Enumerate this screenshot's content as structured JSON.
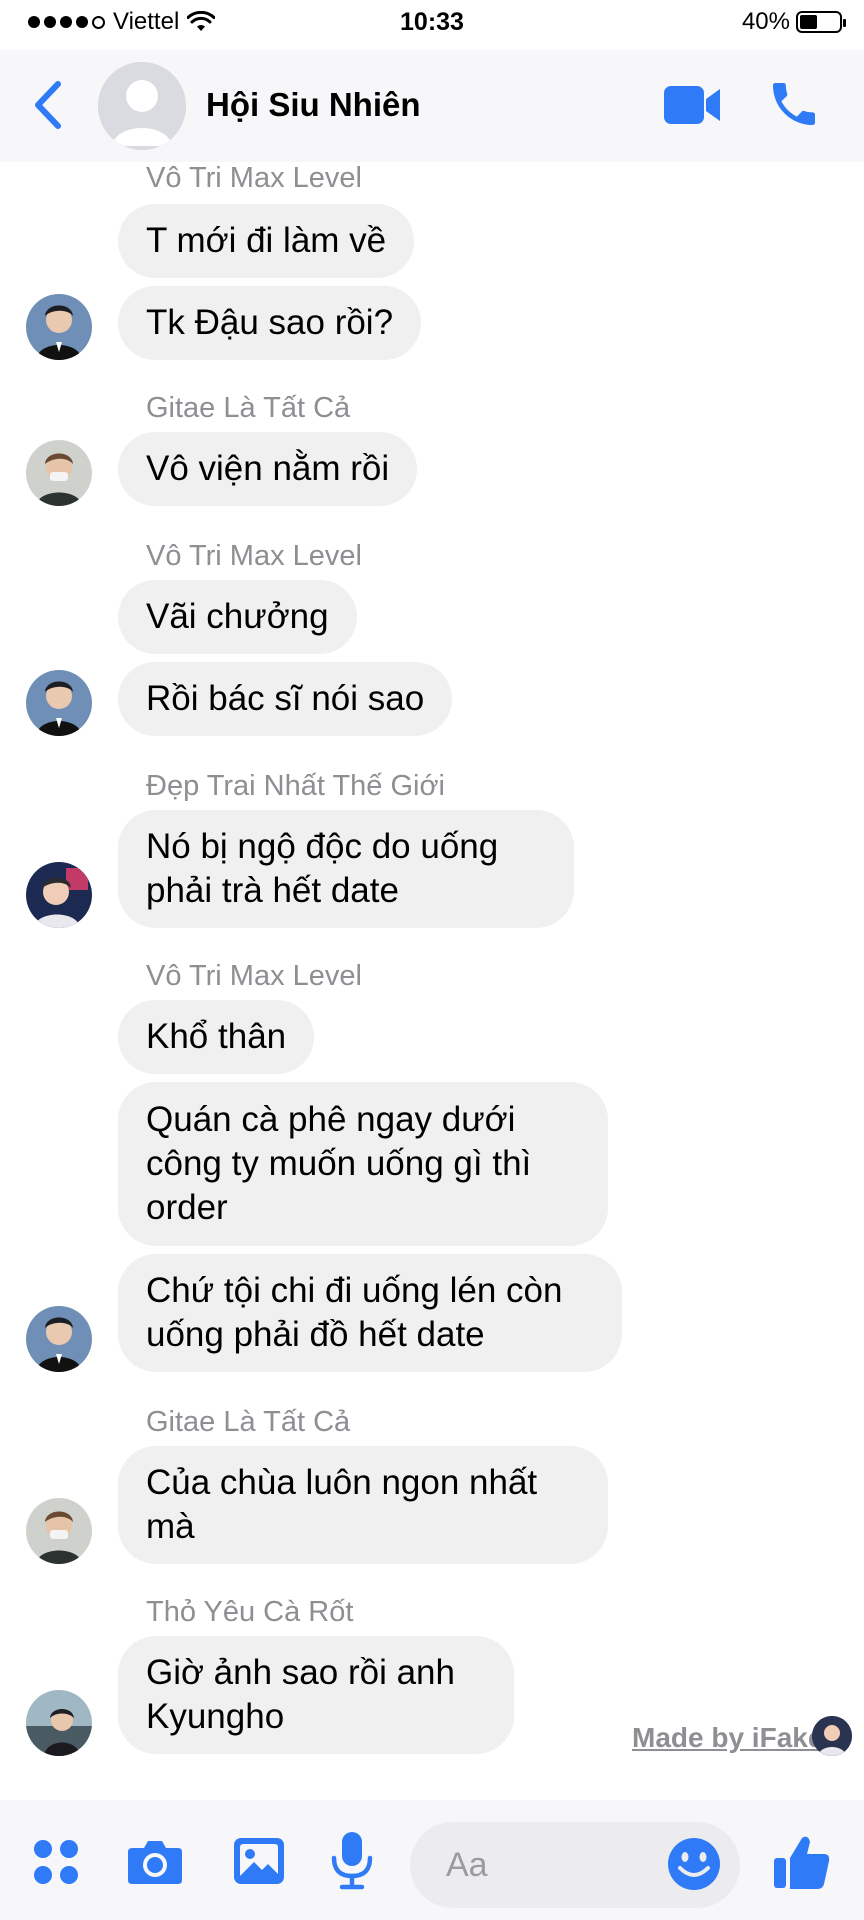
{
  "status_bar": {
    "carrier": "Viettel",
    "time": "10:33",
    "battery": "40%",
    "battery_level": 0.4
  },
  "header": {
    "group_name": "Hội Siu Nhiên"
  },
  "messages": [
    {
      "sender": "Vô Tri Max Level",
      "bubbles": [
        "T mới đi làm về",
        "Tk Đậu sao rồi?"
      ],
      "avatar": "avatar-vo-tri"
    },
    {
      "sender": "Gitae Là Tất Cả",
      "bubbles": [
        "Vô viện nằm rồi"
      ],
      "avatar": "avatar-gitae"
    },
    {
      "sender": "Vô Tri Max Level",
      "bubbles": [
        "Vãi chưởng",
        "Rồi bác sĩ nói sao"
      ],
      "avatar": "avatar-vo-tri"
    },
    {
      "sender": "Đẹp Trai Nhất Thế Giới",
      "bubbles": [
        "Nó bị ngộ độc do uống phải trà hết date"
      ],
      "avatar": "avatar-dep-trai"
    },
    {
      "sender": "Vô Tri Max Level",
      "bubbles": [
        "Khổ thân",
        "Quán cà phê ngay dưới công ty muốn uống gì thì order",
        "Chứ tội chi đi uống lén còn uống phải đồ hết date"
      ],
      "avatar": "avatar-vo-tri"
    },
    {
      "sender": "Gitae Là Tất Cả",
      "bubbles": [
        "Của chùa luôn ngon nhất mà"
      ],
      "avatar": "avatar-gitae"
    },
    {
      "sender": "Thỏ Yêu Cà Rốt",
      "bubbles": [
        "Giờ ảnh sao rồi anh Kyungho"
      ],
      "avatar": "avatar-tho"
    }
  ],
  "watermark": "Made by iFake",
  "composer": {
    "placeholder": "Aa"
  },
  "colors": {
    "accent": "#2f7af6",
    "bubble": "#f0f0f0",
    "sender": "#8e8e93"
  },
  "icons": [
    "back-chevron-icon",
    "video-camera-icon",
    "phone-icon",
    "apps-grid-icon",
    "camera-icon",
    "image-icon",
    "microphone-icon",
    "emoji-icon",
    "thumbs-up-icon"
  ]
}
